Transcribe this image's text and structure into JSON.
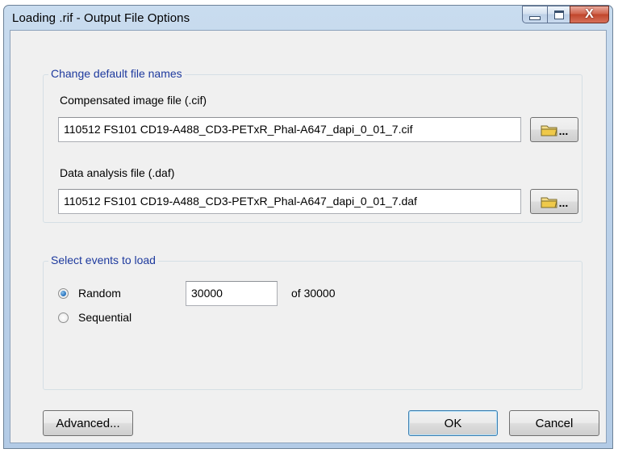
{
  "window": {
    "title": "Loading .rif - Output File Options",
    "buttons": {
      "minimize_icon": "minimize-icon",
      "maximize_icon": "maximize-icon",
      "close_icon": "close-icon",
      "close_glyph": "X"
    },
    "colors": {
      "group_title": "#1e3a9e",
      "close_button": "#c1462c"
    }
  },
  "file_names_group": {
    "title": "Change default file names",
    "cif_label": "Compensated image file (.cif)",
    "cif_value": "110512 FS101 CD19-A488_CD3-PETxR_Phal-A647_dapi_0_01_7.cif",
    "daf_label": "Data analysis file (.daf)",
    "daf_value": "110512 FS101 CD19-A488_CD3-PETxR_Phal-A647_dapi_0_01_7.daf",
    "browse_dots": "...",
    "browse_icon": "folder-icon"
  },
  "events_group": {
    "title": "Select events to load",
    "options": [
      {
        "label": "Random",
        "checked": true
      },
      {
        "label": "Sequential",
        "checked": false
      }
    ],
    "count_value": "30000",
    "of_text": "of 30000"
  },
  "footer": {
    "advanced_label": "Advanced...",
    "ok_label": "OK",
    "cancel_label": "Cancel"
  }
}
